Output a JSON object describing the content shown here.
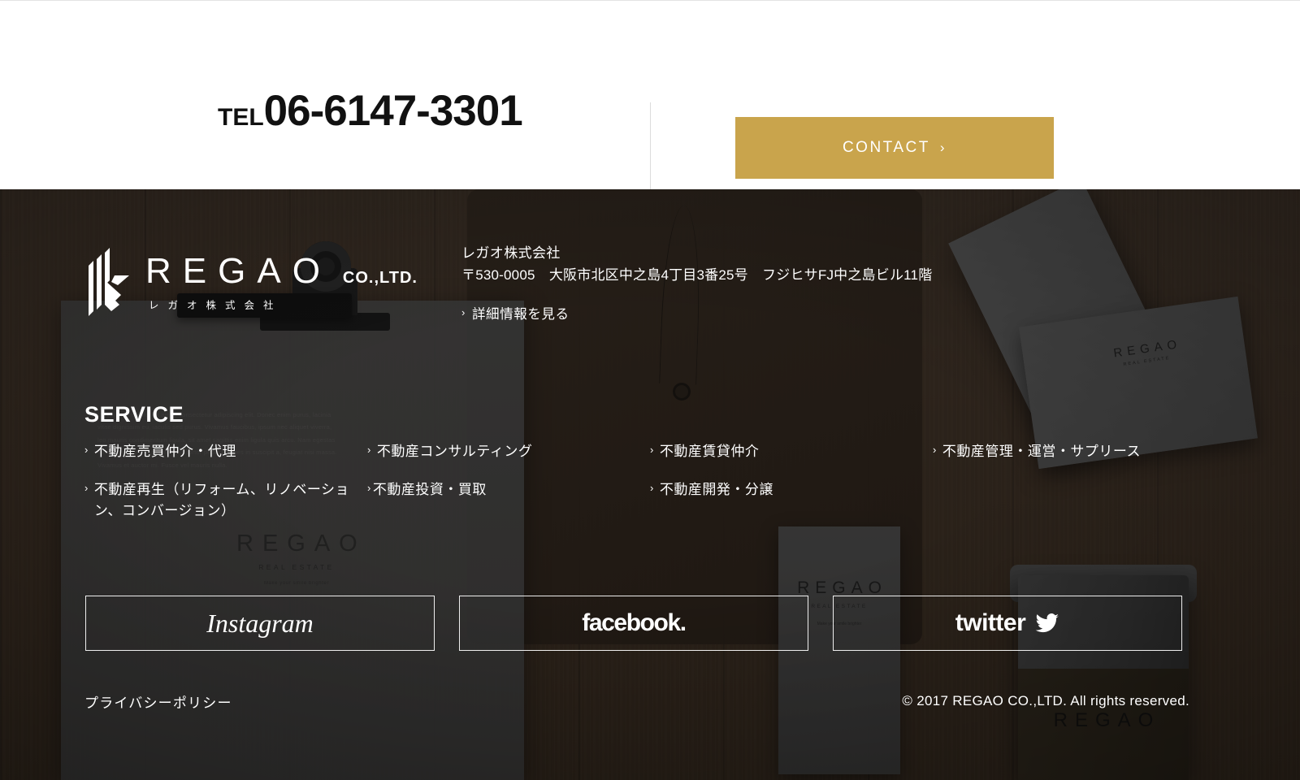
{
  "contact_bar": {
    "tel_label": "TEL",
    "tel_number": "06-6147-3301",
    "contact_button": "CONTACT",
    "contact_chevron": "›"
  },
  "brand": {
    "name": "REGAO",
    "suffix": "CO.,LTD.",
    "jp_name": "レガオ株式会社"
  },
  "address": {
    "company": "レガオ株式会社",
    "line": "〒530-0005　大阪市北区中之島4丁目3番25号　フジヒサFJ中之島ビル11階",
    "more_link": "詳細情報を見る",
    "chevron": "›"
  },
  "service": {
    "title": "SERVICE",
    "chevron": "›",
    "columns": [
      {
        "items": [
          "不動産売買仲介・代理",
          "不動産再生（リフォーム、リノベーション、コンバージョン）"
        ]
      },
      {
        "items": [
          "不動産コンサルティング",
          "不動産投資・買取"
        ]
      },
      {
        "items": [
          "不動産賃貸仲介",
          "不動産開発・分譲"
        ]
      },
      {
        "items": [
          "不動産管理・運営・サプリース"
        ]
      }
    ]
  },
  "socials": [
    {
      "name": "instagram",
      "label": "Instagram"
    },
    {
      "name": "facebook",
      "label": "facebook."
    },
    {
      "name": "twitter",
      "label": "twitter",
      "bird": "🐦"
    }
  ],
  "footer_bottom": {
    "privacy": "プライバシーポリシー",
    "copyright": "© 2017 REGAO CO.,LTD. All rights reserved."
  },
  "photo_props": {
    "paper_logo_word": "REGAO",
    "paper_logo_sub": "REAL ESTATE",
    "paper_logo_tag": "Make your smile brighter",
    "paper_lorem": "Lorem ipsum dolor sit amet, consectetur adipiscing elit. Donec enim purus, lacinia vitae dignissim eu, iaculis sed purus. Vivamus faucibus, ipsum nec aliquet viverra, leo mauris condimentum ligula, sit amet sagittis enim ligula quis arcu. Nam egestas tortor et erat porttitor mattis, in tortor pede, ultricies in suscipit a, feugiat nisi massa. Vivamus et auctor mi. Fusce vel mauris nulla.",
    "card_word": "REGAO",
    "card_sub": "REAL ESTATE",
    "letterhead_word": "REGAO",
    "letterhead_sub": "REAL ESTATE",
    "letterhead_tag": "Make your smile brighter",
    "cup_word": "REGAO"
  },
  "colors": {
    "accent_gold": "#c9a44c",
    "wood_dark": "#3a2d21",
    "text_white": "#ffffff"
  }
}
